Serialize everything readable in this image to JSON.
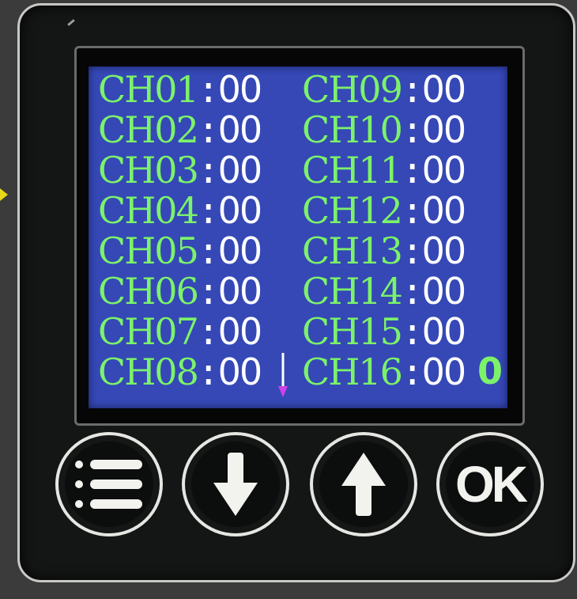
{
  "screen": {
    "channels_left": [
      {
        "label": "CH01",
        "value": "00"
      },
      {
        "label": "CH02",
        "value": "00"
      },
      {
        "label": "CH03",
        "value": "00"
      },
      {
        "label": "CH04",
        "value": "00"
      },
      {
        "label": "CH05",
        "value": "00"
      },
      {
        "label": "CH06",
        "value": "00"
      },
      {
        "label": "CH07",
        "value": "00"
      },
      {
        "label": "CH08",
        "value": "00"
      }
    ],
    "channels_right": [
      {
        "label": "CH09",
        "value": "00"
      },
      {
        "label": "CH10",
        "value": "00"
      },
      {
        "label": "CH11",
        "value": "00"
      },
      {
        "label": "CH12",
        "value": "00"
      },
      {
        "label": "CH13",
        "value": "00"
      },
      {
        "label": "CH14",
        "value": "00"
      },
      {
        "label": "CH15",
        "value": "00"
      },
      {
        "label": "CH16",
        "value": "00"
      }
    ],
    "separator": ":",
    "counter": "0",
    "cursor_icon": "down-arrow-cursor-icon"
  },
  "buttons": {
    "menu": {
      "icon": "menu-list-icon"
    },
    "down": {
      "icon": "arrow-down-icon"
    },
    "up": {
      "icon": "arrow-up-icon"
    },
    "ok": {
      "label": "OK"
    }
  },
  "colors": {
    "lcd_background": "#3548b6",
    "channel_label": "#7cf26a",
    "channel_value": "#ffffff",
    "cursor": "#d040e8",
    "device_body": "#141515",
    "button_ring": "#e6e6e2"
  }
}
